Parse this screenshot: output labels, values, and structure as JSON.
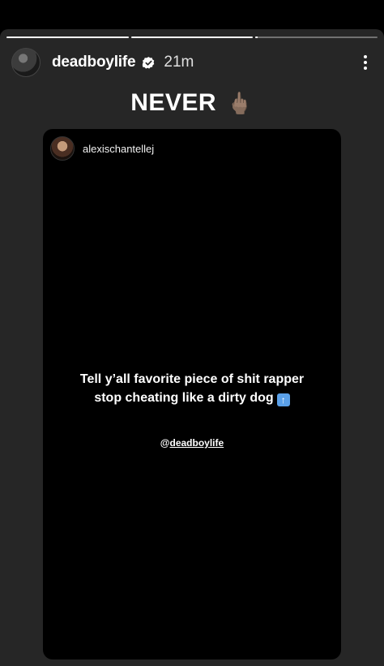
{
  "story": {
    "progress": [
      1,
      1,
      0.02
    ],
    "username": "deadboylife",
    "time": "21m",
    "caption": "NEVER",
    "caption_emoji": "🖕",
    "caption_emoji_icon": "middle-finger-emoji-icon"
  },
  "card": {
    "username": "alexischantellej",
    "text_line1": "Tell y’all favorite piece of shit rapper",
    "text_line2": "stop cheating like a dirty dog",
    "text_emoji": "🚮",
    "text_emoji_icon": "trash-symbol-emoji-icon",
    "mention_at": "@",
    "mention_user": "deadboylife"
  },
  "colors": {
    "story_bg": "#262626",
    "card_bg": "#000000",
    "text": "#ffffff"
  }
}
